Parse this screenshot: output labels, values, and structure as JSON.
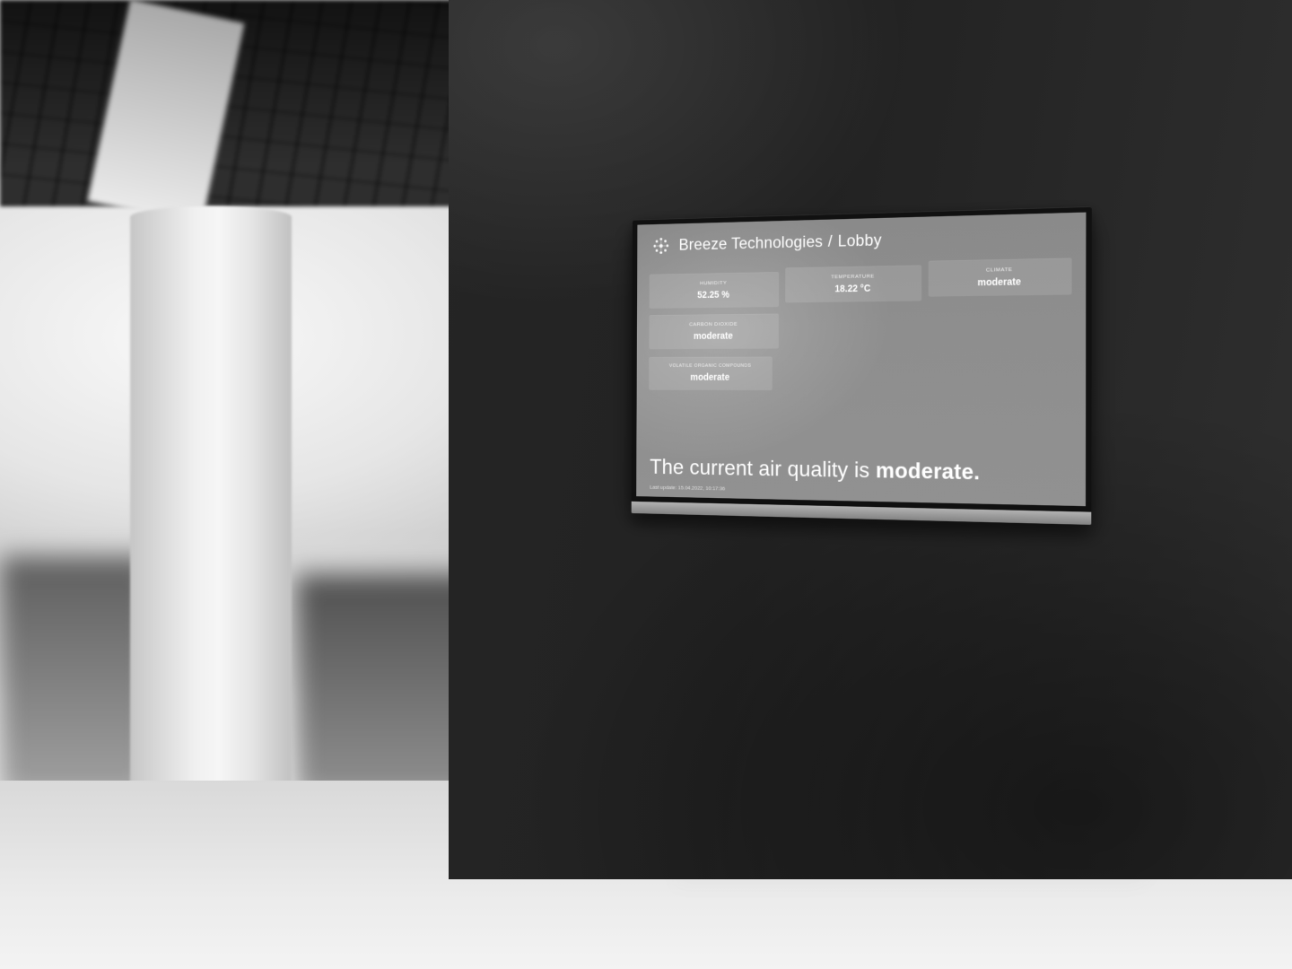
{
  "header": {
    "brand": "Breeze Technologies",
    "separator": "/",
    "location": "Lobby"
  },
  "tiles": [
    {
      "id": "humidity",
      "label": "HUMIDITY",
      "value": "52.25 %"
    },
    {
      "id": "temperature",
      "label": "TEMPERATURE",
      "value": "18.22 °C"
    },
    {
      "id": "climate",
      "label": "CLIMATE",
      "value": "moderate"
    },
    {
      "id": "co2",
      "label": "CARBON DIOXIDE",
      "value": "moderate"
    },
    {
      "id": "voc",
      "label": "VOLATILE ORGANIC COMPOUNDS",
      "value": "moderate"
    }
  ],
  "summary": {
    "prefix": "The current air quality is ",
    "status": "moderate."
  },
  "footer": {
    "last_update_label": "Last update:",
    "last_update_value": "15.04.2022, 10:17:36"
  },
  "colors": {
    "screen_bg": "#5f94da",
    "tile_bg": "rgba(255,255,255,0.12)"
  }
}
